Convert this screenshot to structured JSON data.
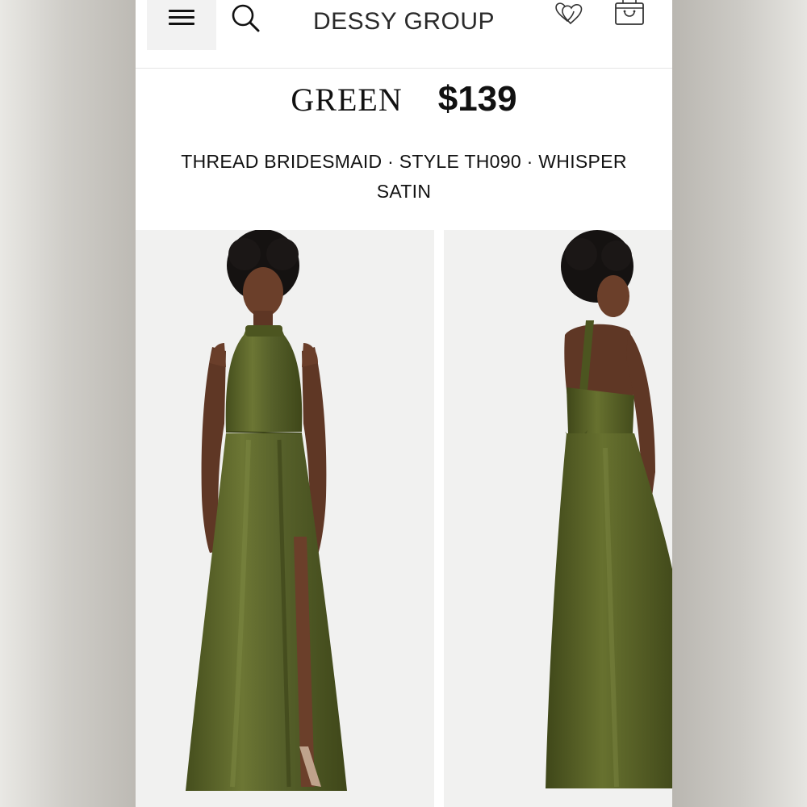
{
  "header": {
    "brand": "DESSY GROUP",
    "menu_icon": "hamburger-menu-icon",
    "search_icon": "search-icon",
    "wishlist_icon": "hearts-icon",
    "bag_icon": "shopping-bag-icon"
  },
  "product": {
    "color": "GREEN",
    "price": "$139",
    "subtitle": "THREAD BRIDESMAID · STYLE TH090 · WHISPER SATIN"
  },
  "gallery": {
    "images": [
      "front-view-photo",
      "back-view-photo"
    ],
    "dress_color": "#586127",
    "background_color": "#f1f1f0"
  }
}
